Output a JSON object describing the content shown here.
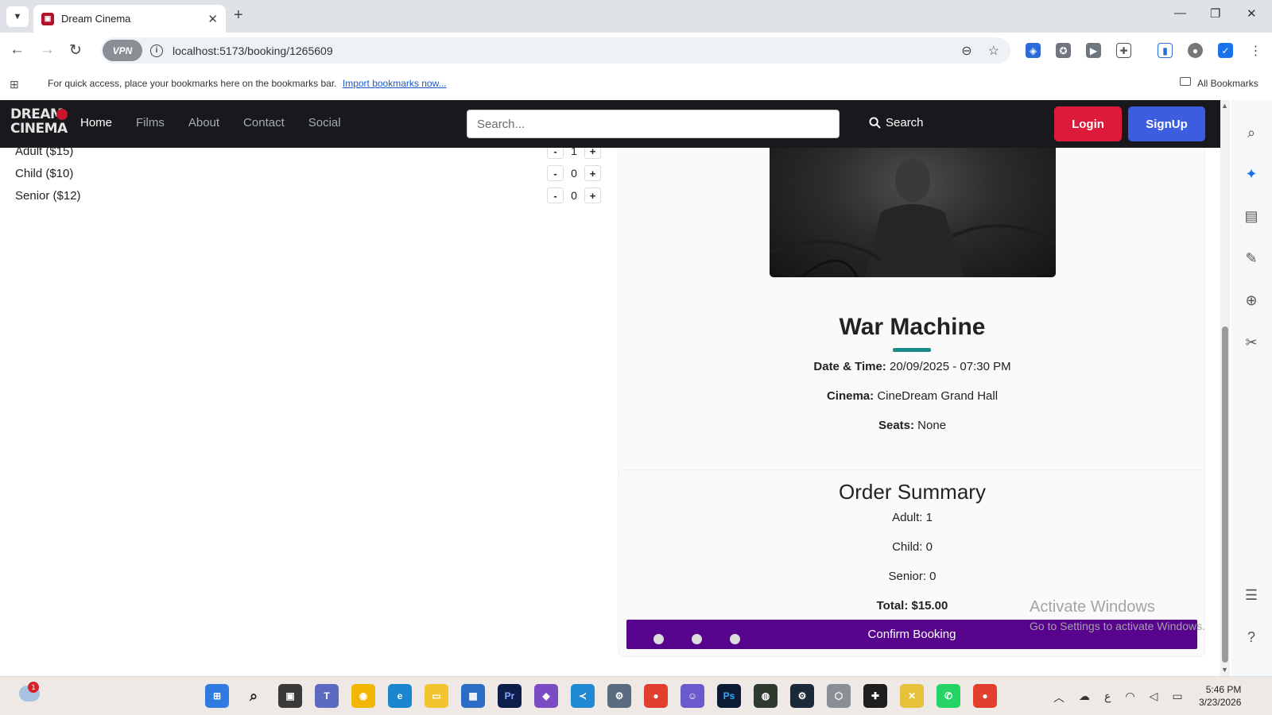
{
  "browser": {
    "tab_title": "Dream Cinema",
    "url": "localhost:5173/booking/1265609",
    "vpn_label": "VPN",
    "bookmarks_text": "For quick access, place your bookmarks here on the bookmarks bar.",
    "bookmarks_link": "Import bookmarks now...",
    "all_bookmarks": "All Bookmarks"
  },
  "navbar": {
    "logo_line1": "DREAM",
    "logo_line2": "CINEMA",
    "links": [
      "Home",
      "Films",
      "About",
      "Contact",
      "Social"
    ],
    "search_placeholder": "Search...",
    "search_button": "Search",
    "login": "Login",
    "signup": "SignUp"
  },
  "tickets": [
    {
      "label": "Adult ($15)",
      "count": "1"
    },
    {
      "label": "Child ($10)",
      "count": "0"
    },
    {
      "label": "Senior ($12)",
      "count": "0"
    }
  ],
  "stepper": {
    "minus": "-",
    "plus": "+"
  },
  "movie": {
    "title": "War Machine",
    "datetime_label": "Date & Time:",
    "datetime_value": "20/09/2025 - 07:30 PM",
    "cinema_label": "Cinema:",
    "cinema_value": "CineDream Grand Hall",
    "seats_label": "Seats:",
    "seats_value": "None"
  },
  "summary": {
    "title": "Order Summary",
    "adult": "Adult: 1",
    "child": "Child: 0",
    "senior": "Senior: 0",
    "total": "Total: $15.00",
    "confirm": "Confirm Booking"
  },
  "watermark": {
    "line1": "Activate Windows",
    "line2": "Go to Settings to activate Windows."
  },
  "taskbar": {
    "notification_count": "1",
    "time": "5:46 PM",
    "date": "3/23/2026",
    "lang": "ع"
  },
  "colors": {
    "navbar_bg": "#17191c",
    "login_red": "#dc1a3a",
    "signup_blue": "#3d5de0",
    "confirm_purple": "#57038e",
    "accent_teal": "#1d8a8a"
  }
}
